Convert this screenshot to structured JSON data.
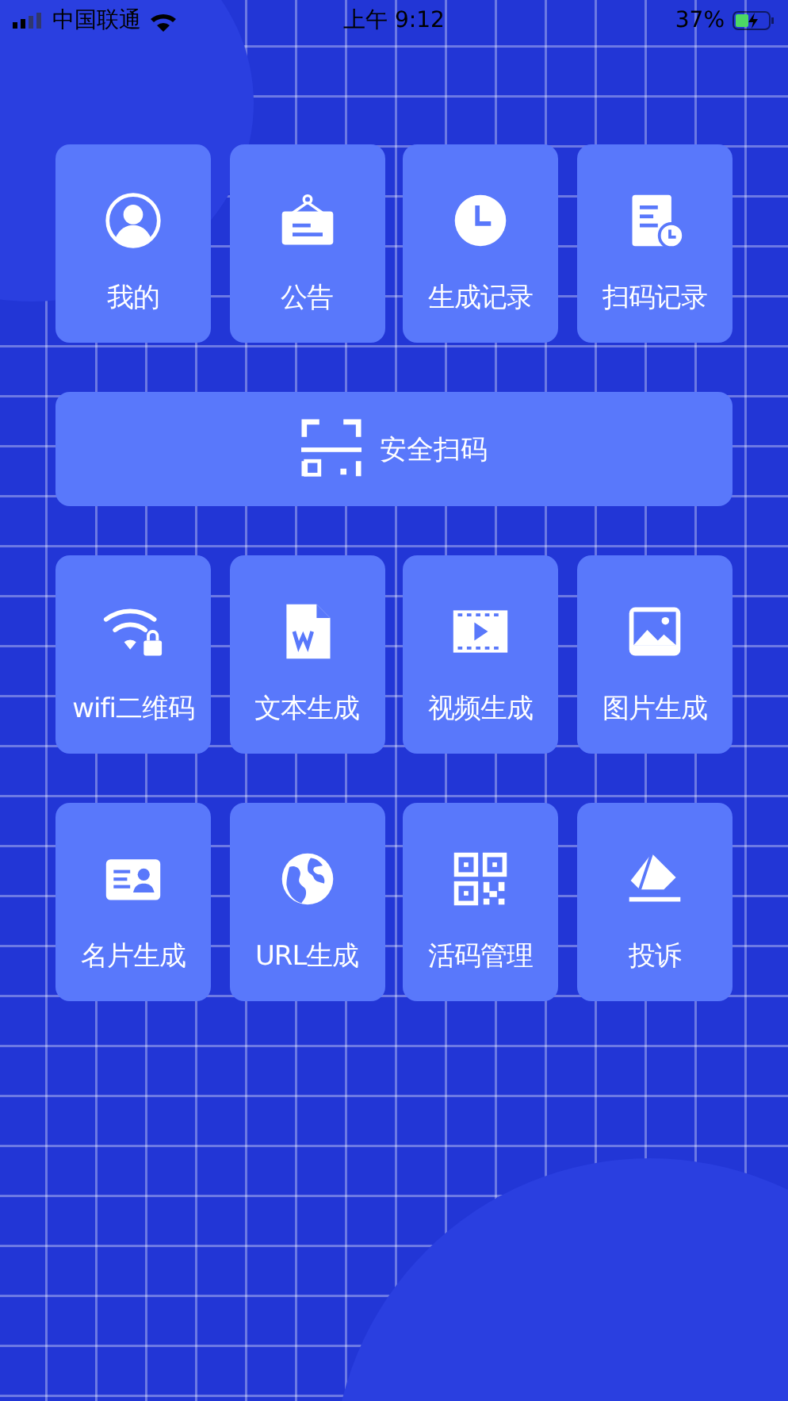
{
  "status_bar": {
    "carrier": "中国联通",
    "time": "上午 9:12",
    "battery": "37%"
  },
  "top_tiles": [
    {
      "label": "我的"
    },
    {
      "label": "公告"
    },
    {
      "label": "生成记录"
    },
    {
      "label": "扫码记录"
    }
  ],
  "scan_button": {
    "label": "安全扫码"
  },
  "tiles": [
    {
      "label": "wifi二维码"
    },
    {
      "label": "文本生成"
    },
    {
      "label": "视频生成"
    },
    {
      "label": "图片生成"
    },
    {
      "label": "名片生成"
    },
    {
      "label": "URL生成"
    },
    {
      "label": "活码管理"
    },
    {
      "label": "投诉"
    }
  ]
}
